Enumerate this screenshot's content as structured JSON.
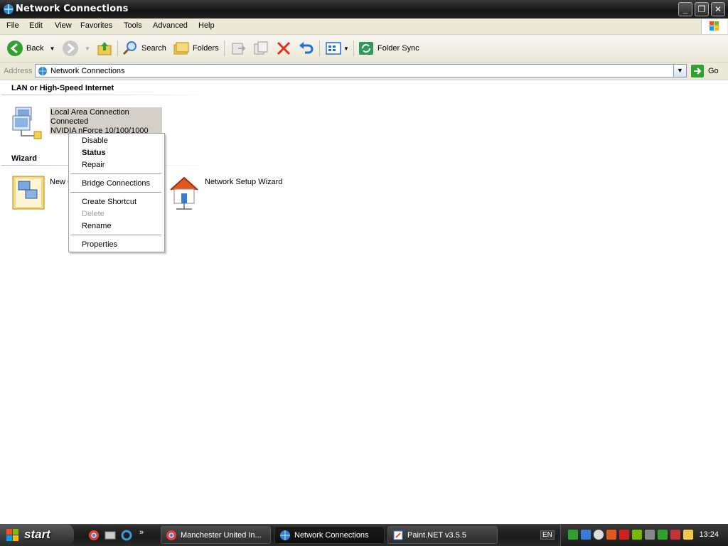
{
  "window": {
    "title": "Network Connections"
  },
  "menubar": {
    "items": [
      "File",
      "Edit",
      "View",
      "Favorites",
      "Tools",
      "Advanced",
      "Help"
    ]
  },
  "toolbar": {
    "back_label": "Back",
    "search_label": "Search",
    "folders_label": "Folders",
    "folder_sync_label": "Folder Sync"
  },
  "address": {
    "label": "Address",
    "value": "Network Connections",
    "go_label": "Go"
  },
  "groups": {
    "lan_header": "LAN or High-Speed Internet",
    "wizard_header": "Wizard"
  },
  "connection": {
    "name": "Local Area Connection",
    "status": "Connected",
    "device": "NVIDIA nForce 10/100/1000"
  },
  "wizards": {
    "new_connection": "New C",
    "network_setup": "Network Setup Wizard"
  },
  "context_menu": {
    "disable": "Disable",
    "status": "Status",
    "repair": "Repair",
    "bridge": "Bridge Connections",
    "create_shortcut": "Create Shortcut",
    "delete": "Delete",
    "rename": "Rename",
    "properties": "Properties"
  },
  "taskbar": {
    "start_label": "start",
    "tasks": [
      "Manchester United In...",
      "Network Connections",
      "Paint.NET v3.5.5"
    ],
    "language": "EN",
    "clock": "13:24"
  },
  "colors": {
    "selection": "#d4d0c8",
    "content_bg": "#ffffff",
    "chrome_bg": "#ece9d8",
    "taskbar": "#1a1a1a"
  }
}
